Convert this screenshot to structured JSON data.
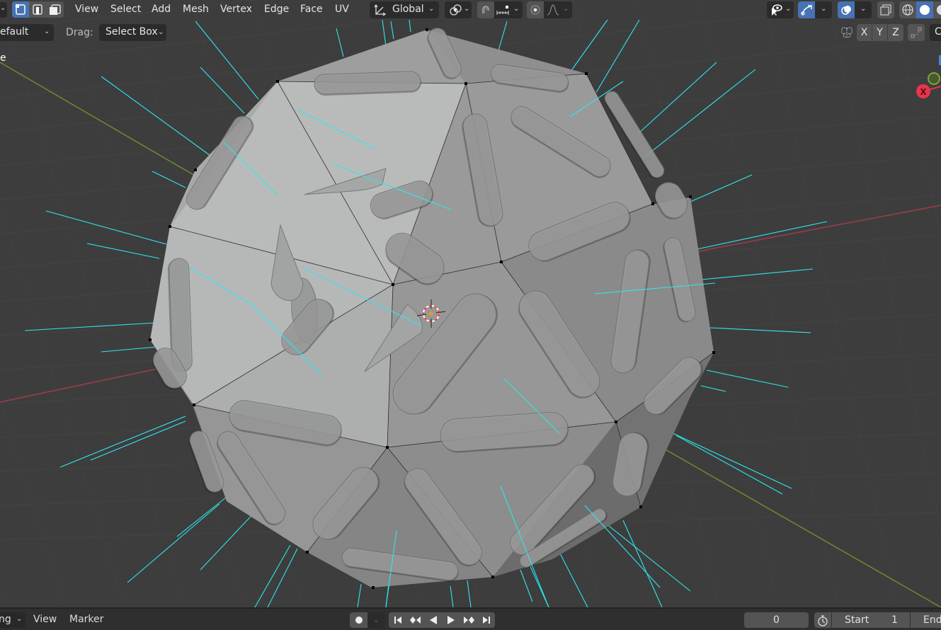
{
  "header": {
    "mode_dropdown_chevron": "⌄",
    "select_modes": [
      {
        "name": "vertex-select",
        "active": true
      },
      {
        "name": "edge-select",
        "active": false
      },
      {
        "name": "face-select",
        "active": false
      }
    ],
    "menus": [
      "View",
      "Select",
      "Add",
      "Mesh",
      "Vertex",
      "Edge",
      "Face",
      "UV"
    ],
    "transform_orientation": {
      "icon": "transform-orientation-icon",
      "label": "Global"
    },
    "pivot": {
      "icon": "pivot-icon"
    },
    "snap": {
      "icon": "snap-magnet-icon",
      "increment_icon": "snap-increment-icon"
    },
    "proportional": {
      "icon": "proportional-edit-icon",
      "falloff_icon": "falloff-curve-icon"
    },
    "right_icons": {
      "visibility": "selectability-visibility-icon",
      "gizmo": "gizmo-icon",
      "overlays": "overlays-icon",
      "xray": "xray-toggle-icon",
      "shading": [
        "wireframe-shading-icon",
        "solid-shading-icon",
        "material-shading-icon"
      ]
    }
  },
  "tool_settings": {
    "keymap_value": "efault",
    "drag_label": "Drag:",
    "drag_value": "Select Box",
    "mirror_icon": "mirror-butterfly-icon",
    "axes": [
      "X",
      "Y",
      "Z"
    ],
    "auto_merge_icon": "auto-merge-icon",
    "cut_off_button_text": "C"
  },
  "viewport": {
    "overlay_text": "e",
    "gizmo": {
      "x_label": "X",
      "x_color": "#e8354a",
      "y_color": "#7ea534",
      "z_color": "#4d82d6"
    },
    "colors": {
      "background": "#3d3d3d",
      "grid": "#494949",
      "x_axis": "#a03d48",
      "y_axis": "#6f8a2c",
      "normals": "#2ee6ee",
      "vertex": "#000000",
      "cursor_ring_a": "#e83a3a",
      "cursor_ring_b": "#ffffff",
      "origin": "#f2932a"
    }
  },
  "timeline": {
    "editor_type_partial": "ng",
    "menus": [
      "View",
      "Marker"
    ],
    "record_icon": "record-keyframe-icon",
    "playback": [
      {
        "name": "jump-start",
        "glyph": "⏮"
      },
      {
        "name": "prev-keyframe",
        "glyph": "◆◀"
      },
      {
        "name": "play-reverse",
        "glyph": "◀"
      },
      {
        "name": "play",
        "glyph": "▶"
      },
      {
        "name": "next-keyframe",
        "glyph": "▶◆"
      },
      {
        "name": "jump-end",
        "glyph": "⏭"
      }
    ],
    "current_frame": "0",
    "timer_icon": "stopwatch-icon",
    "start_label": "Start",
    "start_value": "1",
    "end_label": "End"
  }
}
